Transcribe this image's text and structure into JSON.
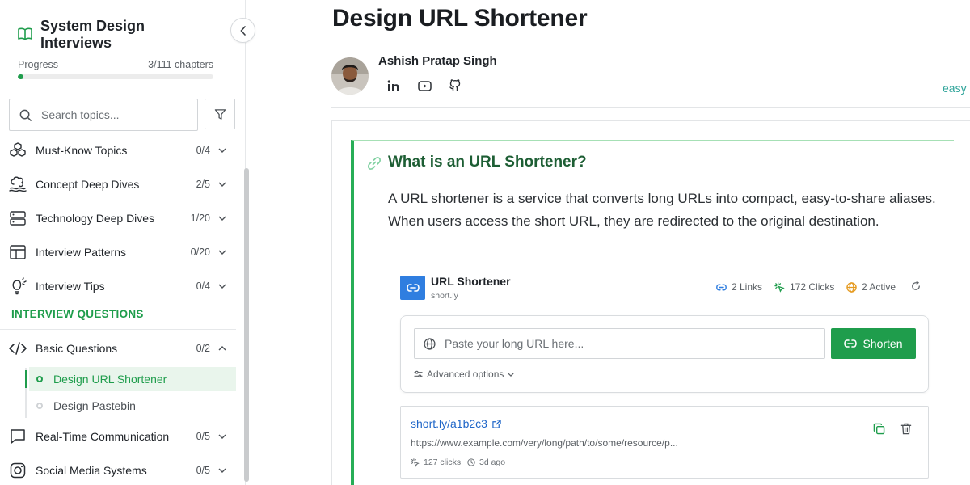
{
  "sidebar": {
    "title": "System Design Interviews",
    "progress": {
      "label": "Progress",
      "count": "3/111 chapters",
      "fraction": 0.027
    },
    "search": {
      "placeholder": "Search topics..."
    },
    "items": [
      {
        "label": "Must-Know Topics",
        "count": "0/4",
        "icon": "cubes-icon"
      },
      {
        "label": "Concept Deep Dives",
        "count": "2/5",
        "icon": "brain-icon"
      },
      {
        "label": "Technology Deep Dives",
        "count": "1/20",
        "icon": "server-icon"
      },
      {
        "label": "Interview Patterns",
        "count": "0/20",
        "icon": "layout-icon"
      },
      {
        "label": "Interview Tips",
        "count": "0/4",
        "icon": "lightbulb-icon"
      }
    ],
    "section_label": "INTERVIEW QUESTIONS",
    "questions": [
      {
        "label": "Basic Questions",
        "count": "0/2",
        "icon": "code-icon",
        "expanded": true,
        "children": [
          {
            "label": "Design URL Shortener",
            "active": true
          },
          {
            "label": "Design Pastebin",
            "active": false
          }
        ]
      },
      {
        "label": "Real-Time Communication",
        "count": "0/5",
        "icon": "chat-icon"
      },
      {
        "label": "Social Media Systems",
        "count": "0/5",
        "icon": "instagram-icon"
      }
    ]
  },
  "main": {
    "title": "Design URL Shortener",
    "author": {
      "name": "Ashish Pratap Singh",
      "socials": [
        "linkedin-icon",
        "youtube-icon",
        "github-icon"
      ]
    },
    "difficulty": "easy",
    "section": {
      "heading": "What is an URL Shortener?",
      "body": "A URL shortener is a service that converts long URLs into compact, easy-to-share aliases. When users access the short URL, they are redirected to the original destination."
    },
    "widget": {
      "title": "URL Shortener",
      "domain": "short.ly",
      "stats": {
        "links": "2 Links",
        "clicks": "172 Clicks",
        "active": "2 Active"
      },
      "input_placeholder": "Paste your long URL here...",
      "shorten_label": "Shorten",
      "advanced_label": "Advanced options",
      "link": {
        "short": "short.ly/a1b2c3",
        "long": "https://www.example.com/very/long/path/to/some/resource/p...",
        "clicks": "127 clicks",
        "age": "3d ago"
      }
    }
  },
  "colors": {
    "accent_green": "#1f9d4c",
    "link_blue": "#1f66c8",
    "difficulty_teal": "#2fa49a",
    "logo_blue": "#2f7ee0"
  }
}
